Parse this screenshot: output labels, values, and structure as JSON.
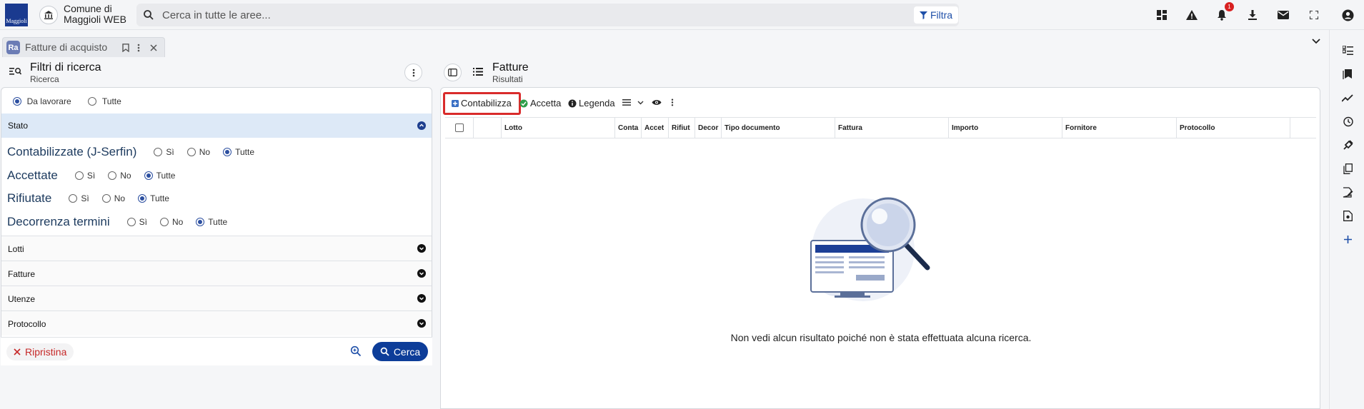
{
  "header": {
    "logo_text": "Maggioli",
    "org_name": "Comune di Maggioli WEB",
    "search_placeholder": "Cerca in tutte le aree...",
    "filter_label": "Filtra",
    "notification_count": "1"
  },
  "tab": {
    "app_abbr": "Ra",
    "label": "Fatture di acquisto"
  },
  "filters": {
    "title": "Filtri di ricerca",
    "subtitle": "Ricerca",
    "top_options": [
      "Da lavorare",
      "Tutte"
    ],
    "section_stato": "Stato",
    "yes": "Sì",
    "no": "No",
    "all": "Tutte",
    "rows": [
      {
        "label": "Contabilizzate (J-Serfin)"
      },
      {
        "label": "Accettate"
      },
      {
        "label": "Rifiutate"
      },
      {
        "label": "Decorrenza termini"
      }
    ],
    "sections": [
      "Lotti",
      "Fatture",
      "Utenze",
      "Protocollo"
    ],
    "reset_label": "Ripristina",
    "search_label": "Cerca"
  },
  "results": {
    "title": "Fatture",
    "subtitle": "Risultati",
    "toolbar": {
      "contabilizza": "Contabilizza",
      "accetta": "Accetta",
      "legenda": "Legenda"
    },
    "columns": [
      "Lotto",
      "Conta",
      "Accet",
      "Rifiut",
      "Decor",
      "Tipo documento",
      "Fattura",
      "Importo",
      "Fornitore",
      "Protocollo"
    ],
    "empty_message": "Non vedi alcun risultato poiché non è stata effettuata alcuna ricerca."
  },
  "colors": {
    "primary": "#0d3d99",
    "accent_light": "#dde9f7",
    "highlight": "#d92b2b",
    "success": "#2e9e4a"
  }
}
